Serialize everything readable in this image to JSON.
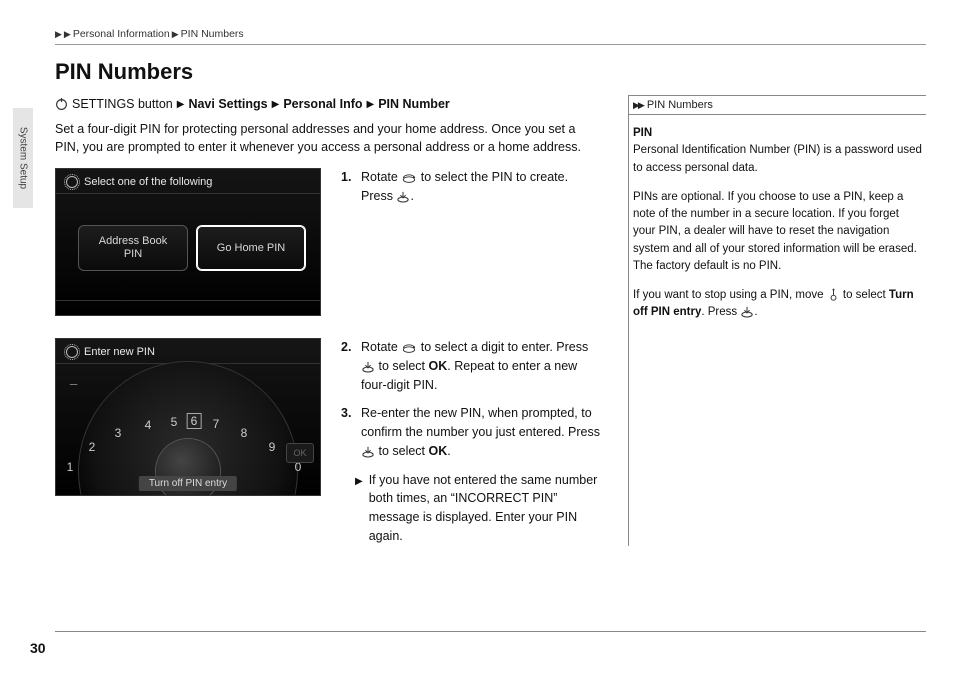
{
  "breadcrumb": {
    "a": "Personal Information",
    "b": "PIN Numbers"
  },
  "heading": "PIN Numbers",
  "navpath": {
    "prefix": "SETTINGS button",
    "p1": "Navi Settings",
    "p2": "Personal Info",
    "p3": "PIN Number"
  },
  "intro": "Set a four-digit PIN for protecting personal addresses and your home address. Once you set a PIN, you are prompted to enter it whenever you access a personal address or a home address.",
  "screenshot1": {
    "title": "Select one of the following",
    "opt_ab_l1": "Address Book",
    "opt_ab_l2": "PIN",
    "opt_gh": "Go Home PIN"
  },
  "screenshot2": {
    "title": "Enter new PIN",
    "cursor": "_",
    "digits": [
      "1",
      "2",
      "3",
      "4",
      "5",
      "6",
      "7",
      "8",
      "9",
      "0"
    ],
    "selected": "6",
    "ok": "OK",
    "turnoff": "Turn off PIN entry"
  },
  "steps": {
    "s1a": "Rotate ",
    "s1b": " to select the PIN to create. Press ",
    "s1c": ".",
    "s2a": "Rotate ",
    "s2b": " to select a digit to enter. Press ",
    "s2c": " to select ",
    "s2_ok": "OK",
    "s2d": ". Repeat to enter a new four-digit PIN.",
    "s3a": "Re-enter the new PIN, when prompted, to confirm the number you just entered. Press ",
    "s3b": " to select ",
    "s3_ok": "OK",
    "s3c": ".",
    "note": "If you have not entered the same number both times, an “INCORRECT PIN” message is displayed. Enter your PIN again."
  },
  "sidebar": {
    "head": "PIN Numbers",
    "pin_label": "PIN",
    "pin_def": "Personal Identification Number (PIN) is a password used to access personal data.",
    "para2": "PINs are optional. If you choose to use a PIN, keep a note of the number in a secure location. If you forget your PIN, a dealer will have to reset the navigation system and all of your stored information will be erased. The factory default is no PIN.",
    "para3a": "If you want to stop using a PIN, move ",
    "para3b": " to select ",
    "para3_bold": "Turn off PIN entry",
    "para3c": ". Press ",
    "para3d": "."
  },
  "sidetab": "System Setup",
  "pagenum": "30"
}
